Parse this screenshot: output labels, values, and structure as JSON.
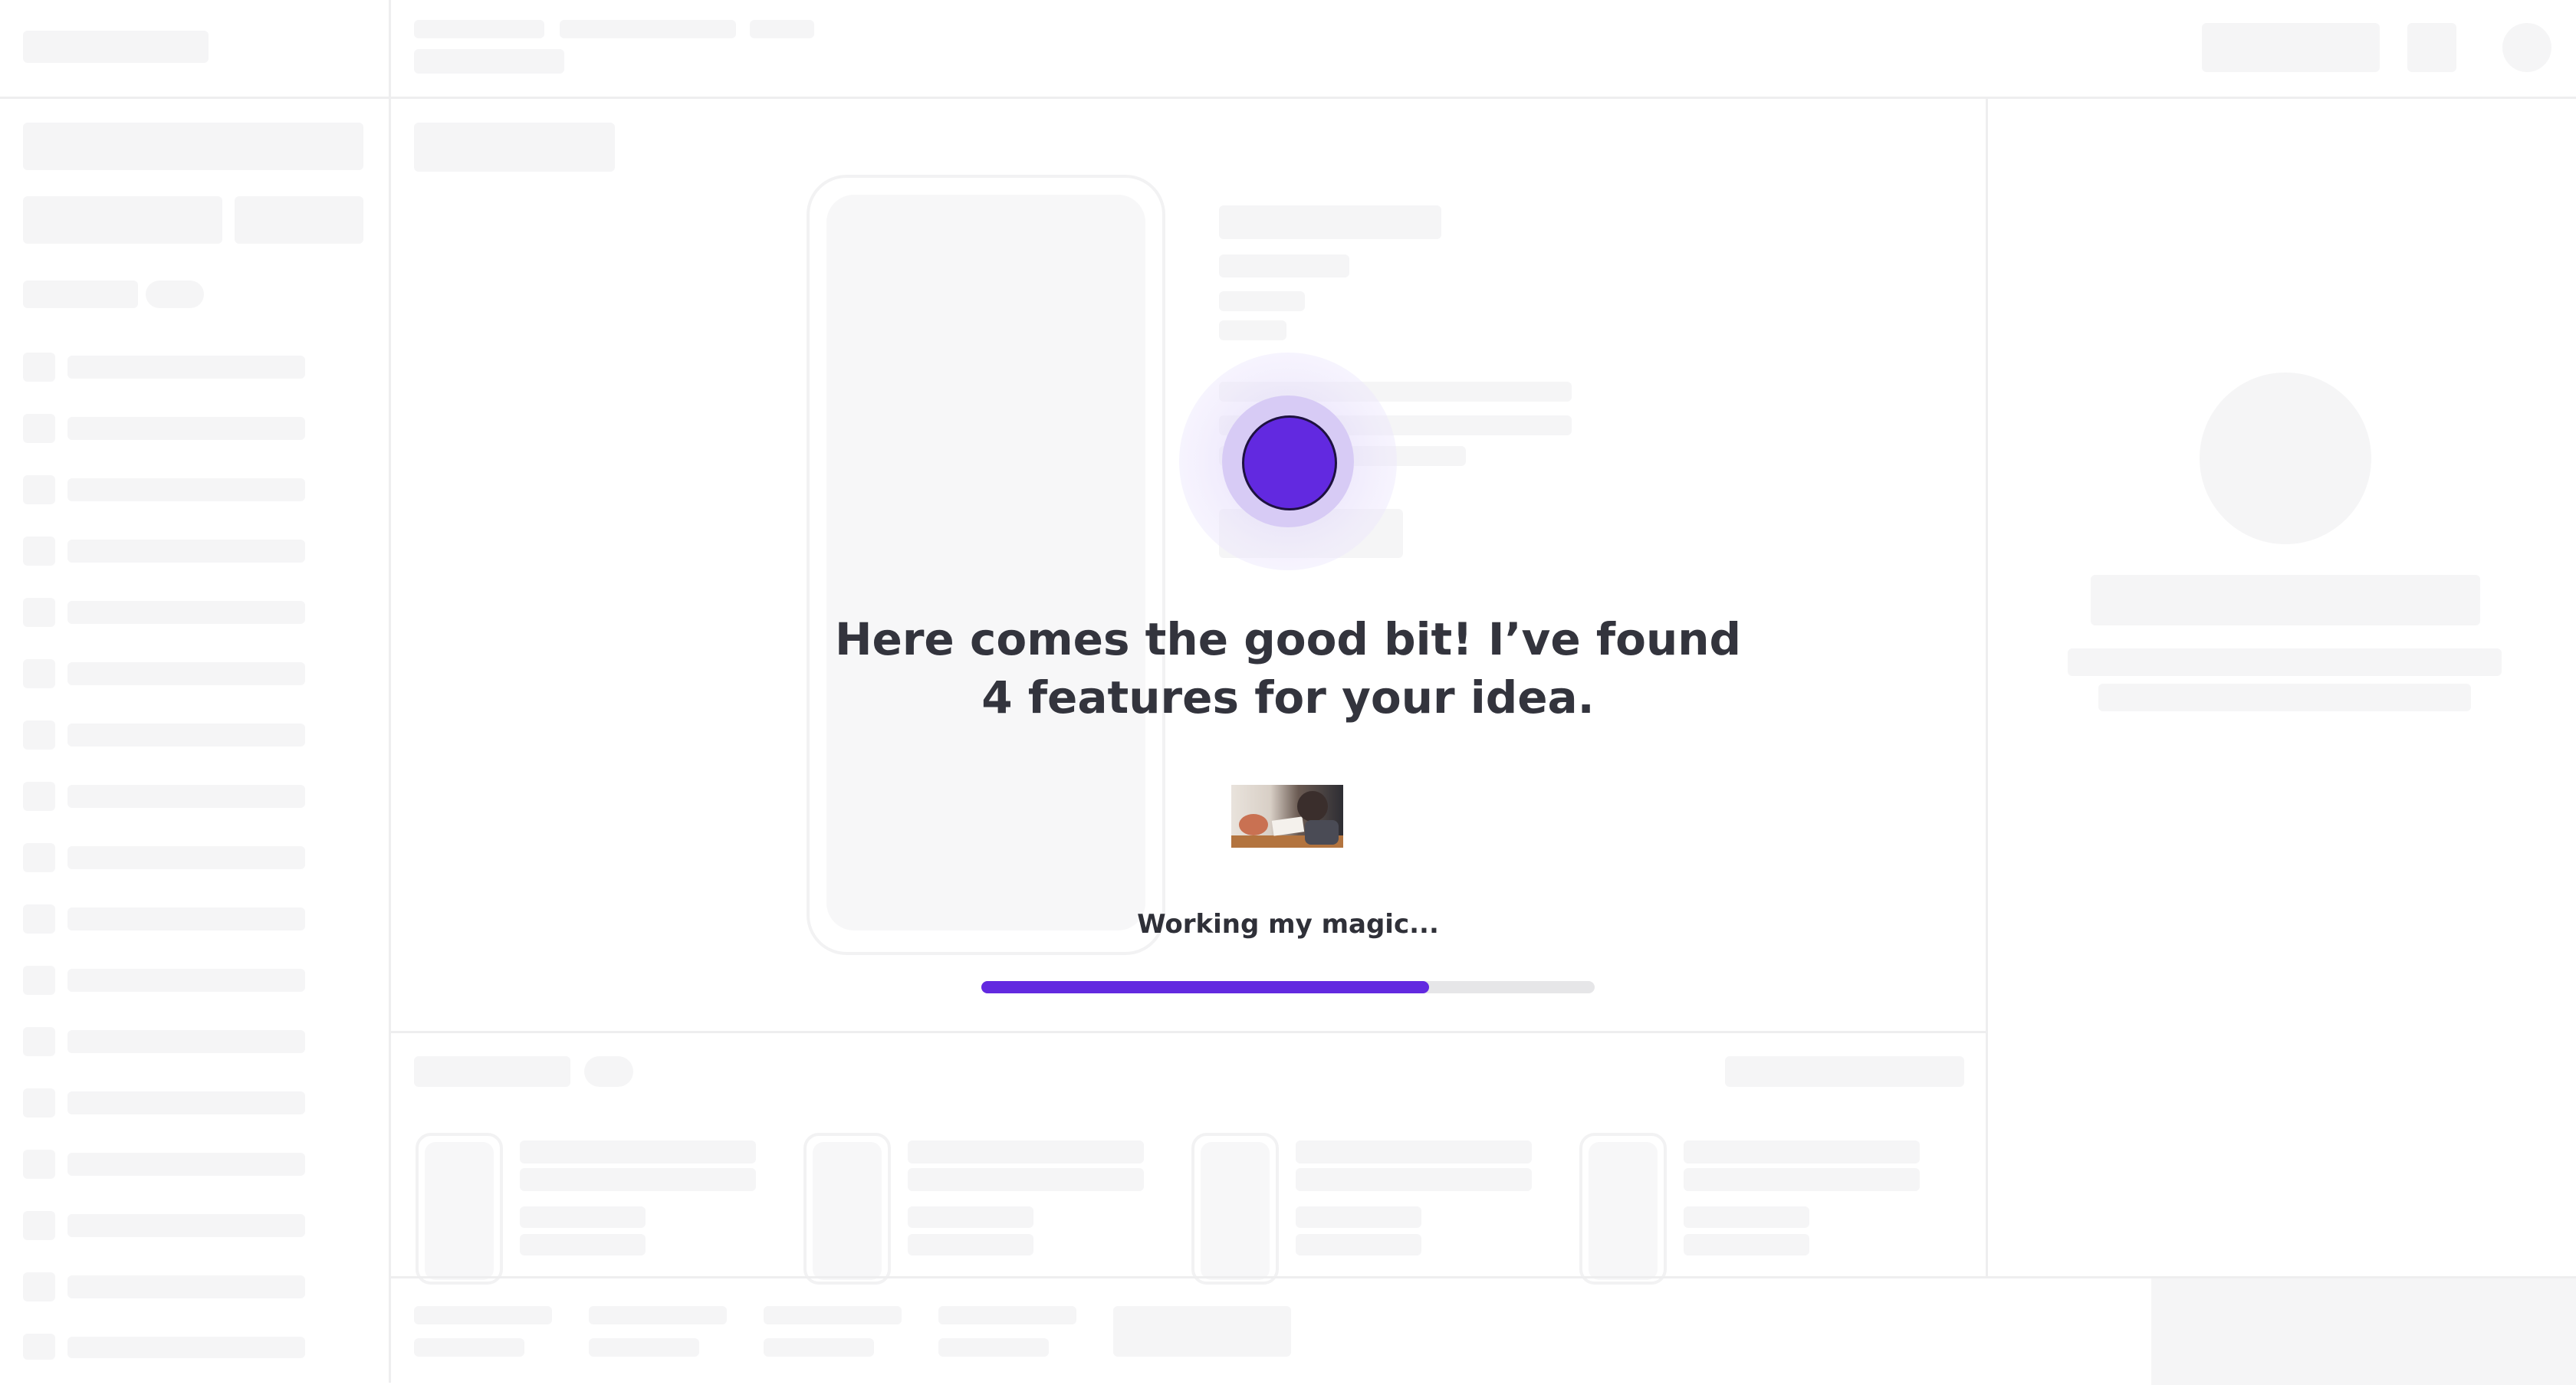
{
  "overlay": {
    "headline": "Here comes the good bit! I’ve found 4 features for your idea.",
    "status_text": "Working my magic...",
    "progress": 0.73,
    "accent_color": "#6229e0",
    "orb_icon": "assistant-orb-icon"
  }
}
